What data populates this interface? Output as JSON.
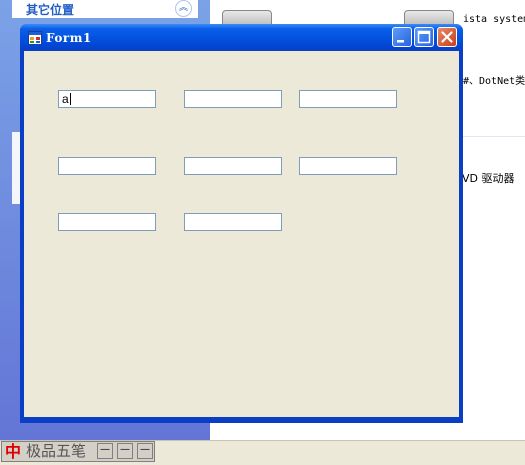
{
  "explorer": {
    "left_pane": {
      "section_title": "其它位置",
      "collapse_icon": "double-chevron-up-icon"
    },
    "partial_texts": [
      "ista system",
      "#、DotNet类",
      "VD 驱动器"
    ]
  },
  "window": {
    "title": "Form1",
    "icon": "form-app-icon",
    "buttons": {
      "minimize_icon": "minimize-icon",
      "maximize_icon": "maximize-icon",
      "close_icon": "close-icon"
    }
  },
  "textboxes": [
    {
      "value": "a",
      "focused": true
    },
    {
      "value": ""
    },
    {
      "value": ""
    },
    {
      "value": ""
    },
    {
      "value": ""
    },
    {
      "value": ""
    },
    {
      "value": ""
    },
    {
      "value": ""
    }
  ],
  "ime_bar": {
    "logo": "中",
    "name": "极品五笔",
    "button_glyph": "—"
  },
  "colors": {
    "titlebar": "#0a5fe8",
    "client_bg": "#ece9d8",
    "textbox_border": "#7f9db9",
    "close_button": "#c8401a"
  }
}
